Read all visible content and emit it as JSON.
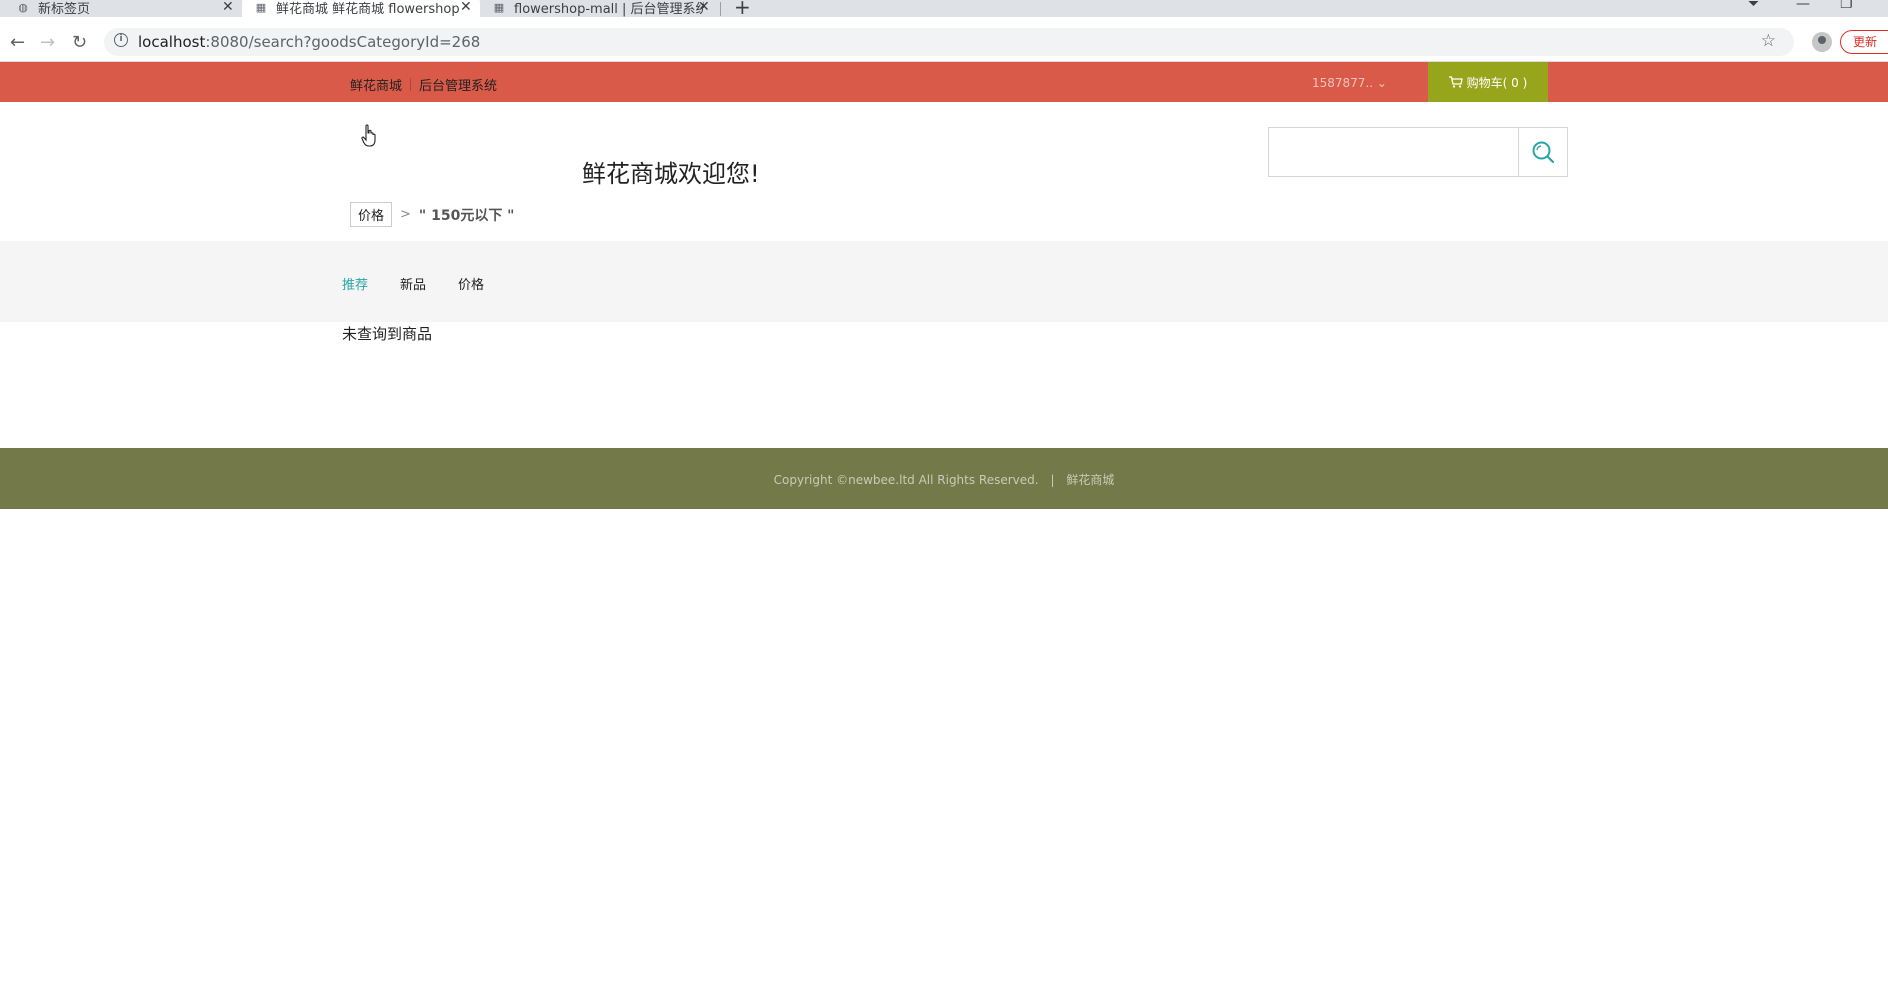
{
  "browser": {
    "tabs": [
      {
        "title": "新标签页",
        "active": false
      },
      {
        "title": "鲜花商城 鲜花商城 flowershop",
        "active": true
      },
      {
        "title": "flowershop-mall | 后台管理系统",
        "active": false
      }
    ],
    "url_host": "localhost",
    "url_rest": ":8080/search?goodsCategoryId=268",
    "update_label": "更新"
  },
  "topbar": {
    "link_mall": "鲜花商城",
    "link_admin": "后台管理系统",
    "user_name": "1587877..",
    "cart_label": "购物车( 0 )",
    "bg_color": "#d95a48",
    "cart_color": "#97a51c"
  },
  "header": {
    "welcome": "鲜花商城欢迎您!",
    "search_placeholder": ""
  },
  "breadcrumb": {
    "filter_label": "价格",
    "filter_value": "\" 150元以下 \""
  },
  "sort": {
    "items": [
      "推荐",
      "新品",
      "价格"
    ],
    "active_color": "#2aa4a4"
  },
  "results": {
    "empty_message": "未查询到商品"
  },
  "footer": {
    "copyright": "Copyright ©newbee.ltd All Rights Reserved.",
    "divider": "|",
    "brand": "鲜花商城",
    "bg_color": "#74794a"
  }
}
